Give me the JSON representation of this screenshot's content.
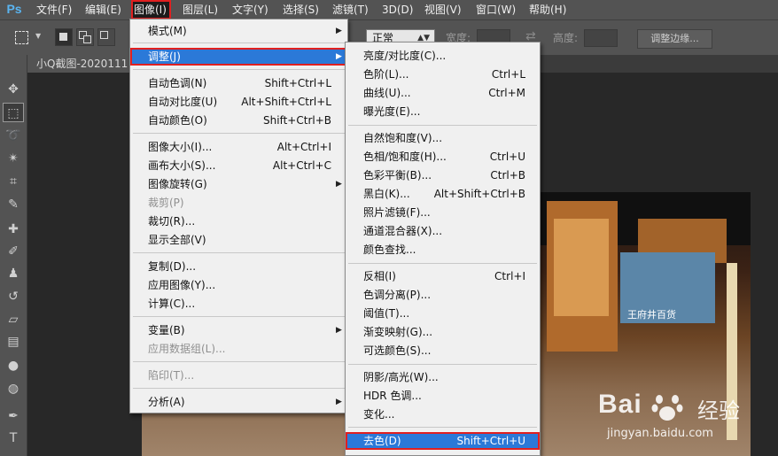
{
  "app": {
    "logo": "Ps"
  },
  "menubar": [
    "文件(F)",
    "编辑(E)",
    "图像(I)",
    "图层(L)",
    "文字(Y)",
    "选择(S)",
    "滤镜(T)",
    "3D(D)",
    "视图(V)",
    "窗口(W)",
    "帮助(H)"
  ],
  "options_bar": {
    "style_value": "正常",
    "width_label": "宽度:",
    "height_label": "高度:",
    "refine_edge_label": "调整边缘..."
  },
  "document": {
    "tab_title": "小Q截图-2020111"
  },
  "image_menu": {
    "items": [
      {
        "label": "模式(M)",
        "shortcut": "",
        "submenu": true
      },
      {
        "label": "调整(J)",
        "shortcut": "",
        "submenu": true,
        "selected": true
      },
      {
        "label": "自动色调(N)",
        "shortcut": "Shift+Ctrl+L"
      },
      {
        "label": "自动对比度(U)",
        "shortcut": "Alt+Shift+Ctrl+L"
      },
      {
        "label": "自动颜色(O)",
        "shortcut": "Shift+Ctrl+B"
      },
      {
        "label": "图像大小(I)...",
        "shortcut": "Alt+Ctrl+I"
      },
      {
        "label": "画布大小(S)...",
        "shortcut": "Alt+Ctrl+C"
      },
      {
        "label": "图像旋转(G)",
        "shortcut": "",
        "submenu": true
      },
      {
        "label": "裁剪(P)",
        "shortcut": "",
        "disabled": true
      },
      {
        "label": "裁切(R)...",
        "shortcut": ""
      },
      {
        "label": "显示全部(V)",
        "shortcut": ""
      },
      {
        "label": "复制(D)...",
        "shortcut": ""
      },
      {
        "label": "应用图像(Y)...",
        "shortcut": ""
      },
      {
        "label": "计算(C)...",
        "shortcut": ""
      },
      {
        "label": "变量(B)",
        "shortcut": "",
        "submenu": true
      },
      {
        "label": "应用数据组(L)...",
        "shortcut": "",
        "disabled": true
      },
      {
        "label": "陷印(T)...",
        "shortcut": "",
        "disabled": true
      },
      {
        "label": "分析(A)",
        "shortcut": "",
        "submenu": true
      }
    ]
  },
  "adjust_menu": {
    "items": [
      {
        "label": "亮度/对比度(C)...",
        "shortcut": ""
      },
      {
        "label": "色阶(L)...",
        "shortcut": "Ctrl+L"
      },
      {
        "label": "曲线(U)...",
        "shortcut": "Ctrl+M"
      },
      {
        "label": "曝光度(E)...",
        "shortcut": ""
      },
      {
        "label": "自然饱和度(V)...",
        "shortcut": ""
      },
      {
        "label": "色相/饱和度(H)...",
        "shortcut": "Ctrl+U"
      },
      {
        "label": "色彩平衡(B)...",
        "shortcut": "Ctrl+B"
      },
      {
        "label": "黑白(K)...",
        "shortcut": "Alt+Shift+Ctrl+B"
      },
      {
        "label": "照片滤镜(F)...",
        "shortcut": ""
      },
      {
        "label": "通道混合器(X)...",
        "shortcut": ""
      },
      {
        "label": "颜色查找...",
        "shortcut": ""
      },
      {
        "label": "反相(I)",
        "shortcut": "Ctrl+I"
      },
      {
        "label": "色调分离(P)...",
        "shortcut": ""
      },
      {
        "label": "阈值(T)...",
        "shortcut": ""
      },
      {
        "label": "渐变映射(G)...",
        "shortcut": ""
      },
      {
        "label": "可选颜色(S)...",
        "shortcut": ""
      },
      {
        "label": "阴影/高光(W)...",
        "shortcut": ""
      },
      {
        "label": "HDR 色调...",
        "shortcut": ""
      },
      {
        "label": "变化...",
        "shortcut": ""
      },
      {
        "label": "去色(D)",
        "shortcut": "Shift+Ctrl+U",
        "selected": true
      }
    ]
  },
  "canvas_image": {
    "sign_text": "王府井百货"
  },
  "watermark": {
    "logo": "Bai",
    "suffix": "经验",
    "url": "jingyan.baidu.com"
  },
  "colors": {
    "menu_highlight": "#2b79d8",
    "callout_red": "#e02020",
    "ui_gray": "#535353"
  }
}
